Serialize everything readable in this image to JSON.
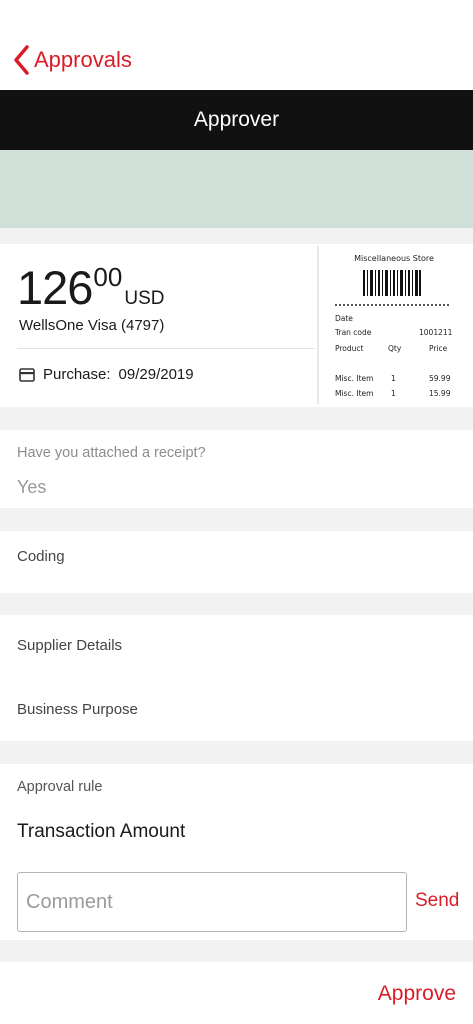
{
  "nav": {
    "back_label": "Approvals",
    "back_icon": "chevron-left-icon"
  },
  "header": {
    "title": "Approver"
  },
  "colors": {
    "accent": "#d71e28",
    "header_bg": "#111111",
    "banner": "#cfe0d8"
  },
  "transaction": {
    "amount_whole": "126",
    "amount_cents": "00",
    "currency": "USD",
    "card": "WellsOne Visa (4797)",
    "purchase_label": "Purchase:",
    "purchase_date": "09/29/2019",
    "purchase_icon": "credit-card-icon"
  },
  "receipt": {
    "store": "Miscellaneous Store",
    "date_label": "Date",
    "tran_code_label": "Tran code",
    "tran_code": "1001211",
    "col_product": "Product",
    "col_qty": "Qty",
    "col_price": "Price",
    "items": [
      {
        "product": "Misc. Item",
        "qty": "1",
        "price": "59.99"
      },
      {
        "product": "Misc. Item",
        "qty": "1",
        "price": "15.99"
      }
    ]
  },
  "receipt_question": {
    "label": "Have you attached a receipt?",
    "value": "Yes"
  },
  "coding": {
    "label": "Coding"
  },
  "details": {
    "supplier_label": "Supplier Details",
    "purpose_label": "Business Purpose"
  },
  "approval": {
    "rule_label": "Approval rule",
    "rule_value": "Transaction Amount",
    "comment_placeholder": "Comment",
    "send_label": "Send"
  },
  "footer": {
    "approve_label": "Approve"
  }
}
